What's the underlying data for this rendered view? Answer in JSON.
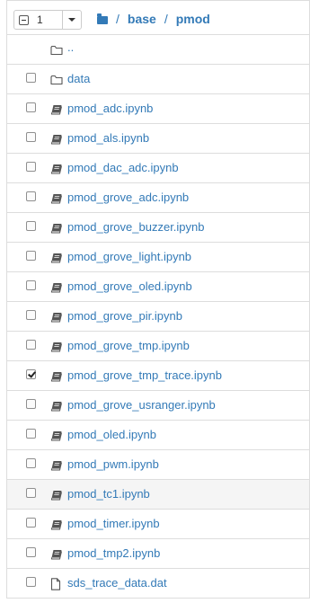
{
  "header": {
    "selected_count": "1",
    "breadcrumb": {
      "root_icon": "folder-icon",
      "items": [
        "base",
        "pmod"
      ],
      "separator": "/"
    }
  },
  "files": [
    {
      "name": "..",
      "icon": "folder-open-icon",
      "checkbox": false,
      "checked": false
    },
    {
      "name": "data",
      "icon": "folder-open-icon",
      "checkbox": true,
      "checked": false
    },
    {
      "name": "pmod_adc.ipynb",
      "icon": "notebook-icon",
      "checkbox": true,
      "checked": false
    },
    {
      "name": "pmod_als.ipynb",
      "icon": "notebook-icon",
      "checkbox": true,
      "checked": false
    },
    {
      "name": "pmod_dac_adc.ipynb",
      "icon": "notebook-icon",
      "checkbox": true,
      "checked": false
    },
    {
      "name": "pmod_grove_adc.ipynb",
      "icon": "notebook-icon",
      "checkbox": true,
      "checked": false
    },
    {
      "name": "pmod_grove_buzzer.ipynb",
      "icon": "notebook-icon",
      "checkbox": true,
      "checked": false
    },
    {
      "name": "pmod_grove_light.ipynb",
      "icon": "notebook-icon",
      "checkbox": true,
      "checked": false
    },
    {
      "name": "pmod_grove_oled.ipynb",
      "icon": "notebook-icon",
      "checkbox": true,
      "checked": false
    },
    {
      "name": "pmod_grove_pir.ipynb",
      "icon": "notebook-icon",
      "checkbox": true,
      "checked": false
    },
    {
      "name": "pmod_grove_tmp.ipynb",
      "icon": "notebook-icon",
      "checkbox": true,
      "checked": false
    },
    {
      "name": "pmod_grove_tmp_trace.ipynb",
      "icon": "notebook-icon",
      "checkbox": true,
      "checked": true
    },
    {
      "name": "pmod_grove_usranger.ipynb",
      "icon": "notebook-icon",
      "checkbox": true,
      "checked": false
    },
    {
      "name": "pmod_oled.ipynb",
      "icon": "notebook-icon",
      "checkbox": true,
      "checked": false
    },
    {
      "name": "pmod_pwm.ipynb",
      "icon": "notebook-icon",
      "checkbox": true,
      "checked": false
    },
    {
      "name": "pmod_tc1.ipynb",
      "icon": "notebook-icon",
      "checkbox": true,
      "checked": false,
      "hover": true
    },
    {
      "name": "pmod_timer.ipynb",
      "icon": "notebook-icon",
      "checkbox": true,
      "checked": false
    },
    {
      "name": "pmod_tmp2.ipynb",
      "icon": "notebook-icon",
      "checkbox": true,
      "checked": false
    },
    {
      "name": "sds_trace_data.dat",
      "icon": "file-icon",
      "checkbox": true,
      "checked": false
    }
  ],
  "colors": {
    "link": "#337ab7",
    "border": "#dddddd",
    "hover_bg": "#f5f5f5",
    "icon": "#555555"
  }
}
